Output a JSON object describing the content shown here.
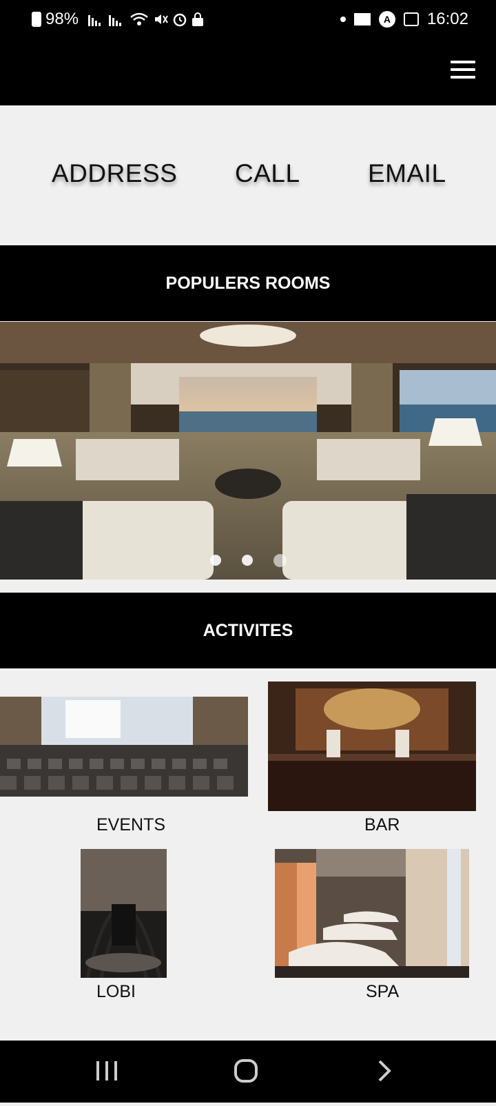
{
  "status_bar": {
    "battery": "98%",
    "time": "16:02",
    "icons": [
      "battery-icon",
      "signal-icon",
      "signal-icon",
      "wifi-icon",
      "mute-icon",
      "alarm-icon",
      "lock-icon",
      "notification-dot-icon",
      "mail-icon",
      "app-icon",
      "gallery-icon"
    ]
  },
  "header": {
    "menu_icon": "hamburger-menu-icon"
  },
  "contact": {
    "address": "ADDRESS",
    "call": "CALL",
    "email": "EMAIL"
  },
  "rooms": {
    "title": "POPULERS ROOMS",
    "slide_count": 3,
    "active_slide": 0
  },
  "activities": {
    "title": "ACTIVITES",
    "items": [
      {
        "label": "EVENTS"
      },
      {
        "label": "BAR"
      },
      {
        "label": "LOBI"
      },
      {
        "label": "SPA"
      }
    ]
  },
  "nav": {
    "recents": "recents-icon",
    "home": "home-icon",
    "back": "back-icon"
  }
}
